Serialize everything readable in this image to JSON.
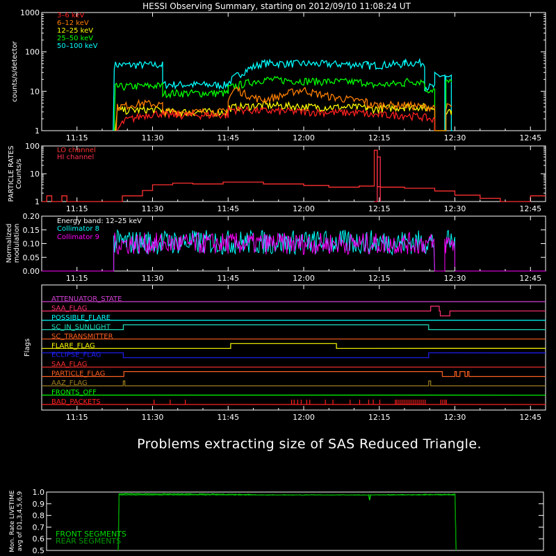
{
  "title": "HESSI Observing Summary, starting on 2012/09/10 11:08:24 UT",
  "message": "Problems extracting size of SAS Reduced Triangle.",
  "colors": {
    "background": "#000000",
    "axes": "#ffffff",
    "c3_6": "#ff2020",
    "c6_12": "#ff7f00",
    "c12_25": "#ffff00",
    "c25_50": "#00ff00",
    "c50_100": "#00ffff",
    "lo": "#ff3030",
    "hi": "#ff3050",
    "coll8": "#00ffff",
    "coll9": "#ff00ff",
    "white": "#ffffff",
    "flag_magenta": "#d040d0",
    "flag_red": "#ff3030",
    "flag_orange": "#ff6020",
    "flag_yellow": "#ffff00",
    "flag_blue": "#2020ff",
    "flag_olive": "#a08020",
    "flag_green": "#00ff00",
    "flag_cyan": "#00ffff",
    "flag_teal": "#20e0c0",
    "flag_pink": "#ff3070",
    "front": "#00dd00",
    "rear": "#009900"
  },
  "chart_data": [
    {
      "id": "count_rates",
      "type": "line",
      "title": "HESSI Observing Summary, starting on 2012/09/10 11:08:24 UT",
      "ylabel": "counts/s/detector",
      "yscale": "log",
      "ylim": [
        1,
        1000
      ],
      "xlim_min": [
        0,
        100
      ],
      "xticks": [
        "11:15",
        "11:30",
        "11:45",
        "12:00",
        "12:15",
        "12:30",
        "12:45"
      ],
      "xtick_min": [
        7,
        22,
        37,
        52,
        67,
        82,
        97
      ],
      "yticks": [
        "1",
        "10",
        "100",
        "1000"
      ],
      "legend": [
        "3–6 keV",
        "6–12 keV",
        "12–25 keV",
        "25–50 keV",
        "50–100 keV"
      ],
      "series": [
        {
          "name": "50–100 keV",
          "color": "#00ffff",
          "x": [
            14.2,
            14.4,
            24,
            24,
            37,
            37,
            44,
            54,
            64.6,
            64.6,
            72,
            72,
            76,
            76,
            78,
            78,
            80,
            80,
            80.2,
            80.2,
            81.3,
            81.3,
            81.6,
            81.6
          ],
          "y": [
            1,
            47,
            47,
            15,
            14.5,
            16,
            52,
            50,
            48,
            45,
            50,
            53,
            53,
            13,
            13,
            25,
            25,
            1,
            1,
            22,
            22,
            1,
            1,
            1
          ]
        },
        {
          "name": "25–50 keV",
          "color": "#00ff00",
          "x": [
            14.4,
            14.6,
            24,
            24,
            37,
            37,
            44,
            54,
            64.6,
            64.6,
            72,
            72,
            76,
            76,
            78,
            78,
            80.2,
            80.2,
            81.3
          ],
          "y": [
            1,
            13,
            14,
            9,
            9,
            12,
            20,
            18,
            17,
            14,
            16,
            18,
            18,
            11,
            11,
            1,
            1,
            17,
            17
          ]
        },
        {
          "name": "12–25 keV",
          "color": "#ffff00",
          "x": [
            14.6,
            15,
            24,
            24,
            37,
            37,
            44,
            54,
            64.6,
            64.6,
            72,
            72,
            76,
            76,
            78,
            78,
            80.2,
            80.2,
            81.3
          ],
          "y": [
            1,
            3.3,
            3.4,
            3.0,
            3.0,
            3.8,
            4.5,
            4.0,
            3.9,
            3.5,
            4.0,
            4.2,
            4.0,
            3.8,
            3.8,
            1,
            1,
            3.2,
            3.2
          ]
        },
        {
          "name": "6–12 keV",
          "color": "#ff7f00",
          "x": [
            14.8,
            15,
            20,
            24,
            24,
            37,
            37,
            38.5,
            40,
            42,
            44,
            48,
            50,
            52,
            54,
            58,
            62,
            64.6,
            64.6,
            72,
            76,
            78,
            78,
            80.2,
            80.2,
            81.3
          ],
          "y": [
            1,
            4,
            5,
            4.5,
            3,
            3,
            6,
            12,
            9,
            7,
            6,
            8,
            10,
            11,
            9,
            7,
            6,
            5.5,
            4.5,
            4.5,
            4,
            4,
            1,
            1,
            4,
            4
          ]
        },
        {
          "name": "3–6 keV",
          "color": "#ff2020",
          "x": [
            15,
            16.5,
            19,
            21,
            24,
            24,
            37,
            37,
            44,
            54,
            64.6,
            64.6,
            72,
            76,
            78,
            78
          ],
          "y": [
            1,
            1.8,
            2.2,
            2.6,
            2.8,
            2.5,
            2.5,
            3.5,
            3.2,
            3.0,
            2.8,
            2.5,
            2.5,
            2.2,
            1.8,
            1
          ]
        }
      ]
    },
    {
      "id": "particle_rates",
      "type": "line",
      "ylabel": "PARTICLE RATES Counts/s",
      "yscale": "log",
      "ylim": [
        1,
        100
      ],
      "yticks": [
        "1",
        "10",
        "100"
      ],
      "xticks": [
        "11:15",
        "11:30",
        "11:45",
        "12:00",
        "12:15",
        "12:30",
        "12:45"
      ],
      "legend": [
        "LO channel",
        "HI channel"
      ],
      "series": [
        {
          "name": "LO channel",
          "color": "#ff3030",
          "x": [
            0,
            1,
            1,
            2,
            2,
            4,
            4,
            5,
            5,
            16,
            16,
            20,
            20,
            22,
            22,
            26,
            26,
            30,
            30,
            36,
            36,
            44,
            44,
            52,
            52,
            57,
            57,
            63,
            63,
            66,
            66,
            66.6,
            66.6,
            67.2,
            67.2,
            72,
            72,
            78,
            78,
            82,
            82,
            87,
            87,
            91,
            91,
            97,
            97,
            100
          ],
          "y": [
            1,
            1,
            1.6,
            1.6,
            1,
            1,
            1.6,
            1.6,
            1,
            1,
            1.6,
            1.6,
            2.5,
            2.5,
            4,
            4,
            4.6,
            4.6,
            4.3,
            4.3,
            5,
            5,
            4.3,
            4.3,
            3.8,
            3.8,
            3.3,
            3.3,
            3.6,
            3.6,
            70,
            70,
            3.4,
            3.4,
            3.3,
            3.3,
            3,
            3,
            2.4,
            2.4,
            1.7,
            1.7,
            1.3,
            1.3,
            1,
            1,
            1.6,
            1.6
          ]
        },
        {
          "name": "HI channel",
          "color": "#ff3050",
          "x": [
            66,
            66.6,
            66.6,
            67.2,
            67.2
          ],
          "y": [
            1,
            1,
            40,
            40,
            1
          ]
        }
      ]
    },
    {
      "id": "modulation",
      "type": "line",
      "ylabel": "Normalized modulation",
      "ylim": [
        0,
        0.2
      ],
      "yticks": [
        "0.00",
        "0.05",
        "0.10",
        "0.15",
        "0.20"
      ],
      "xticks": [
        "11:15",
        "11:30",
        "11:45",
        "12:00",
        "12:15",
        "12:30",
        "12:45"
      ],
      "legend": [
        "Energy band: 12–25 keV",
        "Collimator 8",
        "Collimator 9"
      ],
      "active_ranges_min": [
        [
          14.3,
          78
        ],
        [
          80,
          82
        ]
      ],
      "series": [
        {
          "name": "Collimator 8",
          "color": "#00ffff",
          "mean": 0.105,
          "spread": 0.045
        },
        {
          "name": "Collimator 9",
          "color": "#ff00ff",
          "mean": 0.1,
          "spread": 0.04
        }
      ]
    },
    {
      "id": "flags",
      "type": "line",
      "ylabel": "Flags",
      "xticks": [
        "11:15",
        "11:30",
        "11:45",
        "12:00",
        "12:15",
        "12:30",
        "12:45"
      ],
      "flags": [
        {
          "name": "ATTENUATOR_STATE",
          "color": "#d040d0",
          "steps": [
            [
              0,
              0
            ]
          ]
        },
        {
          "name": "SAA_FLAG",
          "color": "#ff3070",
          "steps": [
            [
              0,
              0
            ],
            [
              77.2,
              1
            ],
            [
              78.9,
              0
            ],
            [
              79.1,
              -1
            ],
            [
              81,
              0
            ]
          ]
        },
        {
          "name": "POSSIBLE_FLARE",
          "color": "#00ffff",
          "steps": [
            [
              0,
              0
            ]
          ]
        },
        {
          "name": "SC_IN_SUNLIGHT",
          "color": "#20e0c0",
          "steps": [
            [
              0,
              0
            ],
            [
              16.2,
              1
            ],
            [
              76.8,
              0
            ]
          ]
        },
        {
          "name": "SC_TRANSMITTER",
          "color": "#ff6020",
          "steps": [
            [
              0,
              0
            ]
          ]
        },
        {
          "name": "FLARE_FLAG",
          "color": "#ffff00",
          "steps": [
            [
              0,
              0
            ],
            [
              37.5,
              1
            ],
            [
              58.5,
              0
            ]
          ]
        },
        {
          "name": "ECLIPSE_FLAG",
          "color": "#2020ff",
          "steps": [
            [
              0,
              1
            ],
            [
              16.2,
              0
            ],
            [
              76.8,
              1
            ]
          ]
        },
        {
          "name": "SAA_FLAG",
          "color": "#ff3030",
          "steps": [
            [
              0,
              0
            ]
          ]
        },
        {
          "name": "PARTICLE_FLAG",
          "color": "#ff6020",
          "steps": [
            [
              0,
              0
            ],
            [
              16.3,
              1
            ],
            [
              79.5,
              0
            ],
            [
              81.5,
              0
            ],
            [
              82,
              1
            ],
            [
              82.3,
              0
            ],
            [
              83,
              1
            ],
            [
              84,
              0
            ],
            [
              84.5,
              1
            ],
            [
              84.8,
              0
            ]
          ]
        },
        {
          "name": "AAZ_FLAG",
          "color": "#a08020",
          "steps": [
            [
              0,
              0
            ],
            [
              16.2,
              1
            ],
            [
              16.5,
              0
            ],
            [
              76.8,
              1
            ],
            [
              77.2,
              0
            ]
          ]
        },
        {
          "name": "FRONTS_OFF",
          "color": "#00ff00",
          "steps": [
            [
              0,
              0
            ]
          ]
        },
        {
          "name": "BAD_PACKETS",
          "color": "#ff2020",
          "ticks_min": [
            22.3,
            25.5,
            28.5,
            49.6,
            50.1,
            50.8,
            51.5,
            52.6,
            53.2,
            56.3,
            57.8,
            61.2,
            63.1,
            64.9,
            65.8,
            67.1,
            70.2,
            70.5,
            70.9,
            71.3,
            71.7,
            72.1,
            72.5,
            72.9,
            73.3,
            73.7,
            74.1,
            74.5,
            74.9,
            75.3,
            75.7,
            76.1,
            79.2,
            79.6,
            80.0,
            80.3
          ]
        }
      ]
    },
    {
      "id": "livetime",
      "type": "line",
      "ylabel": "Mon. Rate LIVETIME avg of D1,3,4,5,6,9",
      "ylim": [
        0.5,
        1.0
      ],
      "yticks": [
        "0.5",
        "0.6",
        "0.7",
        "0.8",
        "0.9",
        "1.0"
      ],
      "legend": [
        "FRONT SEGMENTS",
        "REAR SEGMENTS"
      ],
      "series": [
        {
          "name": "FRONT SEGMENTS",
          "color": "#00dd00",
          "x": [
            14.4,
            14.6,
            40,
            44,
            64.8,
            65,
            65.2,
            80,
            82.2,
            82.4
          ],
          "y": [
            0.5,
            0.985,
            0.98,
            0.975,
            0.975,
            0.93,
            0.975,
            0.98,
            0.98,
            0.5
          ]
        },
        {
          "name": "REAR SEGMENTS",
          "color": "#009900",
          "x": [
            14.4,
            14.6,
            82.2,
            82.4
          ],
          "y": [
            0.5,
            0.975,
            0.975,
            0.5
          ]
        }
      ]
    }
  ]
}
